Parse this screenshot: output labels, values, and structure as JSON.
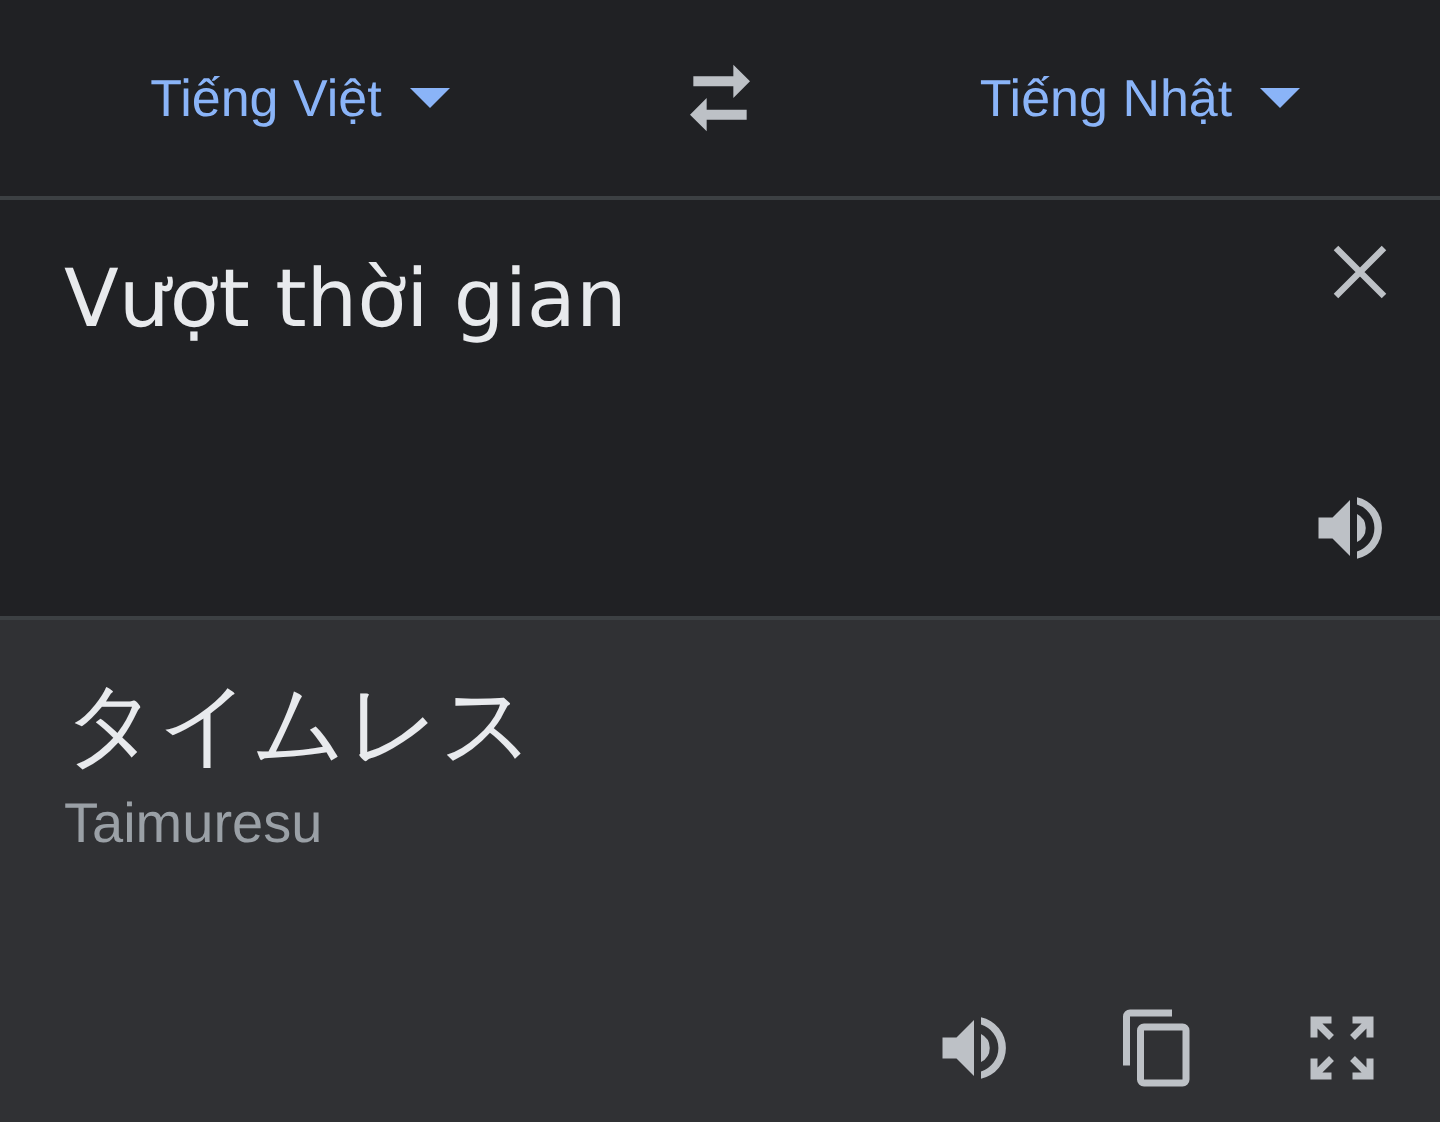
{
  "language_bar": {
    "source_language": "Tiếng Việt",
    "target_language": "Tiếng Nhật"
  },
  "input": {
    "value": "Vượt thời gian"
  },
  "output": {
    "translation": "タイムレス",
    "romanization": "Taimuresu"
  }
}
